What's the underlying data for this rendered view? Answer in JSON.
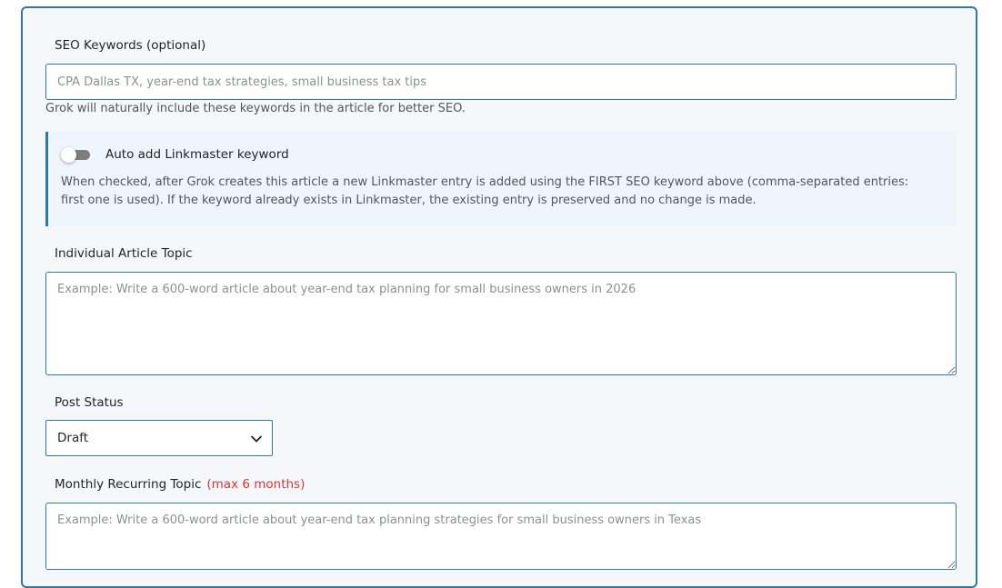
{
  "seo_keywords": {
    "label": "SEO Keywords (optional)",
    "placeholder": "CPA Dallas TX, year-end tax strategies, small business tax tips",
    "value": "",
    "help": "Grok will naturally include these keywords in the article for better SEO."
  },
  "linkmaster": {
    "toggle_label": "Auto add Linkmaster keyword",
    "checked": false,
    "description": "When checked, after Grok creates this article a new Linkmaster entry is added using the FIRST SEO keyword above (comma-separated entries: first one is used). If the keyword already exists in Linkmaster, the existing entry is preserved and no change is made."
  },
  "article_topic": {
    "label": "Individual Article Topic",
    "placeholder": "Example: Write a 600-word article about year-end tax planning for small business owners in 2026"
  },
  "post_status": {
    "label": "Post Status",
    "selected": "Draft"
  },
  "monthly_topic": {
    "label": "Monthly Recurring Topic",
    "limit_note": "(max 6 months)",
    "placeholder": "Example: Write a 600-word article about year-end tax planning strategies for small business owners in Texas"
  },
  "colors": {
    "accent": "#2f79a9",
    "warning": "#d63638",
    "notice_bg": "#eef5fd"
  }
}
